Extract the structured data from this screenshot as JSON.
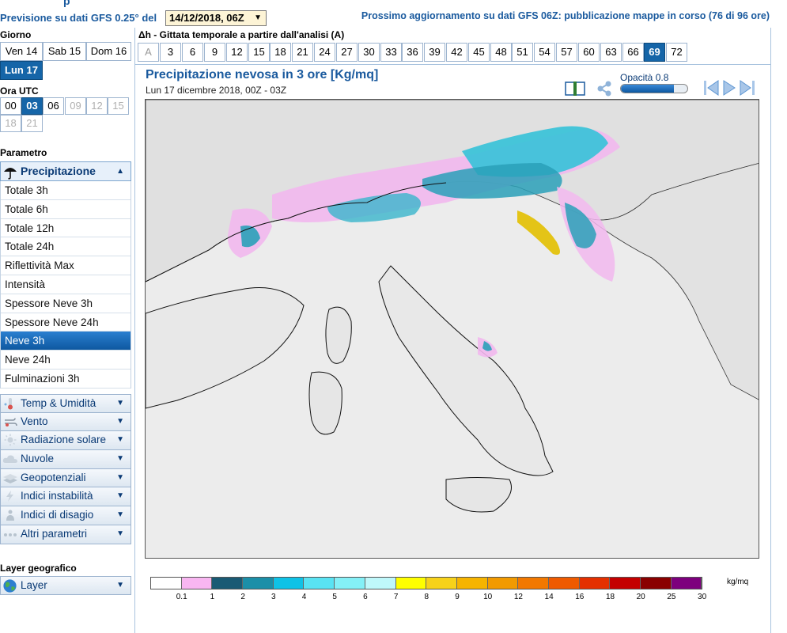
{
  "header": {
    "partial_title": "p",
    "prev_label": "Previsione su dati GFS 0.25° del",
    "date_value": "14/12/2018, 06Z",
    "next_update": "Prossimo aggiornamento su dati GFS 06Z: pubblicazione mappe in corso (76 di 96 ore)"
  },
  "sidebar": {
    "day_label": "Giorno",
    "days": [
      "Ven 14",
      "Sab 15",
      "Dom 16",
      "Lun 17"
    ],
    "selected_day": "Lun 17",
    "utc_label": "Ora UTC",
    "utc_hours": [
      "00",
      "03",
      "06",
      "09",
      "12",
      "15",
      "18",
      "21"
    ],
    "utc_selected": "03",
    "utc_disabled": [
      "09",
      "12",
      "15",
      "18",
      "21"
    ],
    "param_label": "Parametro",
    "param_head": "Precipitazione",
    "sub_items": [
      "Totale 3h",
      "Totale 6h",
      "Totale 12h",
      "Totale 24h",
      "Riflettività Max",
      "Intensità",
      "Spessore Neve 3h",
      "Spessore Neve 24h",
      "Neve 3h",
      "Neve 24h",
      "Fulminazioni 3h"
    ],
    "sub_selected": "Neve 3h",
    "categories": [
      "Temp & Umidità",
      "Vento",
      "Radiazione solare",
      "Nuvole",
      "Geopotenziali",
      "Indici instabilità",
      "Indici di disagio",
      "Altri parametri"
    ],
    "layer_label": "Layer geografico",
    "layer_value": "Layer"
  },
  "main": {
    "dh_label": "Δh - Gittata temporale a partire dall'analisi (A)",
    "timesteps": [
      "A",
      "3",
      "6",
      "9",
      "12",
      "15",
      "18",
      "21",
      "24",
      "27",
      "30",
      "33",
      "36",
      "39",
      "42",
      "45",
      "48",
      "51",
      "54",
      "57",
      "60",
      "63",
      "66",
      "69",
      "72"
    ],
    "timestep_selected": "69",
    "map_title": "Precipitazione nevosa in 3 ore [Kg/mq]",
    "map_subtitle": "Lun 17 dicembre 2018, 00Z - 03Z",
    "opacity_label": "Opacità 0.8",
    "opacity_value": 0.8
  },
  "legend": {
    "unit": "kg/mq",
    "colors": [
      "#ffffff",
      "#f8b6f1",
      "#1a5a74",
      "#1b8fa8",
      "#0fc2e6",
      "#59e3f3",
      "#84f0f7",
      "#bff8fb",
      "#ffff00",
      "#f7d21a",
      "#f6b400",
      "#f29a00",
      "#f27800",
      "#ef5a00",
      "#e43000",
      "#c40000",
      "#8a0000",
      "#7d007d"
    ],
    "labels": [
      "0.1",
      "1",
      "2",
      "3",
      "4",
      "5",
      "6",
      "7",
      "8",
      "9",
      "10",
      "12",
      "14",
      "16",
      "18",
      "20",
      "25",
      "30"
    ]
  },
  "icons": {
    "precip": "umbrella-icon",
    "temp": "thermometer-icon",
    "wind": "wind-icon",
    "radiation": "sun-icon",
    "clouds": "cloud-icon",
    "geo": "layers-icon",
    "instab": "lightning-icon",
    "disagio": "person-icon",
    "altri": "dots-icon",
    "layer": "globe-icon"
  }
}
